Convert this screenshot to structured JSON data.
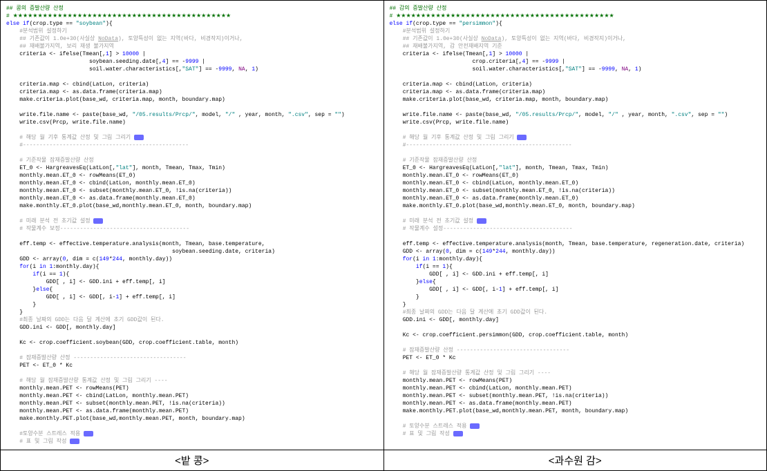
{
  "left": {
    "title_comment": "## 콩의 증발산량 산정",
    "stars": "# ★★★★★★★★★★★★★★★★★★★★★★★★★★★★★★★★★★★★★★★★★★★★",
    "else_key": "else if",
    "cond": "(crop.type == ",
    "cond_str": "\"soybean\"",
    "cond_end": "){",
    "c1": "#분석범위 설정하기",
    "c2": "## 기존값이 1.0e+30(사실상 ",
    "c2_ud": "NoData",
    "c2_b": "), 토양특성이 없는 지역(바다, 비경작지)이거나,",
    "c3": "## 재배불가지역, 보리 재생 불가지역",
    "crit1": "    criteria <- ifelse(Tmean[,",
    "crit1_num": "1",
    "crit1_b": "] > ",
    "crit1_num2": "10000",
    "crit1_c": " |",
    "crit2": "                         soybean.seeding.date[,",
    "crit2_num": "4",
    "crit2_b": "] == -",
    "crit2_num2": "9999",
    "crit2_c": " |",
    "crit3": "                         soil.water.characteristics[,",
    "crit3_str": "\"SAT\"",
    "crit3_b": "] == -",
    "crit3_num": "9999",
    "crit3_c": ", ",
    "crit3_na": "NA",
    "crit3_d": ", ",
    "crit3_num2": "1",
    "crit3_e": ")",
    "cm1": "    criteria.map <- cbind(LatLon, criteria)",
    "cm2": "    criteria.map <- as.data.frame(criteria.map)",
    "cm3": "    make.criteria.plot(base_wd, criteria.map, month, boundary.map)",
    "wf1": "    write.file.name <- paste(base_wd, ",
    "wf1_s1": "\"/05.results/Prcp/\"",
    "wf1_a": ", model, ",
    "wf1_s2": "\"/\"",
    "wf1_b": " , year, month, ",
    "wf1_s3": "\".csv\"",
    "wf1_c": ", sep = ",
    "wf1_s4": "\"\"",
    "wf1_d": ")",
    "wf2": "    write.csv(Prcp, write.file.name)",
    "c4": "    # 해당 월 기후 통계값 산정 및 그림 그리기 ",
    "dash": "    #--------------------------------------------------",
    "c5": "    # 기준작물 잠재증발산량 산정",
    "et1": "    ET_0 <- HargreavesEq(LatLon[,",
    "et1_s": "\"lat\"",
    "et1_b": "], month, Tmean, Tmax, Tmin)",
    "et2": "    monthly.mean.ET_0 <- rowMeans(ET_0)",
    "et3": "    monthly.mean.ET_0 <- cbind(LatLon, monthly.mean.ET_0)",
    "et4": "    monthly.mean.ET_0 <- subset(monthly.mean.ET_0, !is.na(criteria))",
    "et5": "    monthly.mean.ET_0 <- as.data.frame(monthly.mean.ET_0)",
    "et6": "    make.monthly.ET_0.plot(base_wd,monthly.mean.ET_0, month, boundary.map)",
    "c6": "    # 미래 분석 전 초기값 설정 ",
    "c7": "    # 작물계수 보정---------------------------------------",
    "ef1": "    eff.temp <- effective.temperature.analysis(month, Tmean, base.temperature,",
    "ef1b": "                                                  soybean.seeding.date, criteria)",
    "gd1": "    GDD <- array(",
    "gd1_n1": "0",
    "gd1_a": ", dim = c(",
    "gd1_n2": "149",
    "gd1_b": "*",
    "gd1_n3": "244",
    "gd1_c": ", monthly.day))",
    "for1": "    for",
    "for1_b": "(i ",
    "for1_in": "in",
    "for1_c": " ",
    "for1_n": "1",
    "for1_d": ":monthly.day){",
    "if1": "        if",
    "if1_b": "(i == ",
    "if1_n": "1",
    "if1_c": "){",
    "gd2": "            GDD[ , i] <- GDD.ini + eff.temp[, i]",
    "else1": "        }",
    "else1k": "else",
    "else1b": "{",
    "gd3": "            GDD[ , i] <- GDD[, i-",
    "gd3_n": "1",
    "gd3_b": "] + eff.temp[, i]",
    "close1": "        }",
    "close2": "    }",
    "c8": "    #최종 날짜의 GDD는 다음 달 계산에 초기 GDD값이 된다.",
    "gd4": "    GDD.ini <- GDD[, monthly.day]",
    "kc1": "    Kc <- crop.coefficient.soybean(GDD, crop.coefficient.table, month)",
    "c9": "    # 잠재증발산량 산정 ----------------------------------",
    "pet1": "    PET <- ET_0 * Kc",
    "c10": "    # 해당 월 잠재증발산량 통계값 산정 및 그림 그리기 ----",
    "pt1": "    monthly.mean.PET <- rowMeans(PET)",
    "pt2": "    monthly.mean.PET <- cbind(LatLon, monthly.mean.PET)",
    "pt3": "    monthly.mean.PET <- subset(monthly.mean.PET, !is.na(criteria))",
    "pt4": "    monthly.mean.PET <- as.data.frame(monthly.mean.PET)",
    "pt5": "    make.monthly.PET.plot(base_wd,monthly.mean.PET, month, boundary.map)",
    "c11": "    #토양수분 스트레스 적용 ",
    "c12": "    # 표 및 그림 작성 ",
    "caption": "<밭 콩>"
  },
  "right": {
    "title_comment": "## 감의 증발산량 산정",
    "stars": "# ★★★★★★★★★★★★★★★★★★★★★★★★★★★★★★★★★★★★★★★★★★★★",
    "else_key": "else if",
    "cond": "(crop.type == ",
    "cond_str": "\"persimmon\"",
    "cond_end": "){",
    "c1": "#분석범위 설정하기",
    "c2": "## 기존값이 1.0e+30(사실상 ",
    "c2_ud": "NoData",
    "c2_b": "), 토양특성이 없는 지역(바다, 비경작지)이거나,",
    "c3": "## 재배불가지역, 감 안전재배지역 기준",
    "crit1": "    criteria <- ifelse(Tmean[,",
    "crit1_num": "1",
    "crit1_b": "] > ",
    "crit1_num2": "10000",
    "crit1_c": " |",
    "crit2": "                         crop.criteria[,",
    "crit2_num": "4",
    "crit2_b": "] == -",
    "crit2_num2": "9999",
    "crit2_c": " |",
    "crit3": "                         soil.water.characteristics[,",
    "crit3_str": "\"SAT\"",
    "crit3_b": "] == -",
    "crit3_num": "9999",
    "crit3_c": ", ",
    "crit3_na": "NA",
    "crit3_d": ", ",
    "crit3_num2": "1",
    "crit3_e": ")",
    "cm1": "    criteria.map <- cbind(LatLon, criteria)",
    "cm2": "    criteria.map <- as.data.frame(criteria.map)",
    "cm3": "    make.criteria.plot(base_wd, criteria.map, month, boundary.map)",
    "wf1": "    write.file.name <- paste(base_wd, ",
    "wf1_s1": "\"/05.results/Prcp/\"",
    "wf1_a": ", model, ",
    "wf1_s2": "\"/\"",
    "wf1_b": " , year, month, ",
    "wf1_s3": "\".csv\"",
    "wf1_c": ", sep = ",
    "wf1_s4": "\"\"",
    "wf1_d": ")",
    "wf2": "    write.csv(Prcp, write.file.name)",
    "c4": "    # 해당 월 기후 통계값 산정 및 그림 그리기 ",
    "dash": "    #--------------------------------------------------",
    "c5": "    # 기준작물 잠재증발산량 산정",
    "et1": "    ET_0 <- HargreavesEq(LatLon[,",
    "et1_s": "\"lat\"",
    "et1_b": "], month, Tmean, Tmax, Tmin)",
    "et2": "    monthly.mean.ET_0 <- rowMeans(ET_0)",
    "et3": "    monthly.mean.ET_0 <- cbind(LatLon, monthly.mean.ET_0)",
    "et4": "    monthly.mean.ET_0 <- subset(monthly.mean.ET_0, !is.na(criteria))",
    "et5": "    monthly.mean.ET_0 <- as.data.frame(monthly.mean.ET_0)",
    "et6": "    make.monthly.ET_0.plot(base_wd,monthly.mean.ET_0, month, boundary.map)",
    "c6": "    # 미래 분석 전 초기값 설정 ",
    "c7": "    # 작물계수 설정---------------------------------------",
    "ef1": "    eff.temp <- effective.temperature.analysis(month, Tmean, base.temperature, regeneration.date, criteria)",
    "gd1": "    GDD <- array(",
    "gd1_n1": "0",
    "gd1_a": ", dim = c(",
    "gd1_n2": "149",
    "gd1_b": "*",
    "gd1_n3": "244",
    "gd1_c": ", monthly.day))",
    "for1": "    for",
    "for1_b": "(i ",
    "for1_in": "in",
    "for1_c": " ",
    "for1_n": "1",
    "for1_d": ":monthly.day){",
    "if1": "        if",
    "if1_b": "(i == ",
    "if1_n": "1",
    "if1_c": "){",
    "gd2": "            GDD[ , i] <- GDD.ini + eff.temp[, i]",
    "else1": "        }",
    "else1k": "else",
    "else1b": "{",
    "gd3": "            GDD[ , i] <- GDD[, i-",
    "gd3_n": "1",
    "gd3_b": "] + eff.temp[, i]",
    "close1": "        }",
    "close2": "    }",
    "c8": "    #최종 날짜의 GDD는 다음 달 계산에 초기 GDD값이 된다.",
    "gd4": "    GDD.ini <- GDD[, monthly.day]",
    "kc1": "    Kc <- crop.coefficient.persimmon(GDD, crop.coefficient.table, month)",
    "c9": "    # 잠재증발산량 산정 ----------------------------------",
    "pet1": "    PET <- ET_0 * Kc",
    "c10": "    # 해당 월 잠재증발산량 통계값 산정 및 그림 그리기 ----",
    "pt1": "    monthly.mean.PET <- rowMeans(PET)",
    "pt2": "    monthly.mean.PET <- cbind(LatLon, monthly.mean.PET)",
    "pt3": "    monthly.mean.PET <- subset(monthly.mean.PET, !is.na(criteria))",
    "pt4": "    monthly.mean.PET <- as.data.frame(monthly.mean.PET)",
    "pt5": "    make.monthly.PET.plot(base_wd,monthly.mean.PET, month, boundary.map)",
    "c11": "    # 토양수분 스트레스 적용 ",
    "c12": "    # 표 및 그림 작성 ",
    "caption": "<과수원 감>"
  }
}
